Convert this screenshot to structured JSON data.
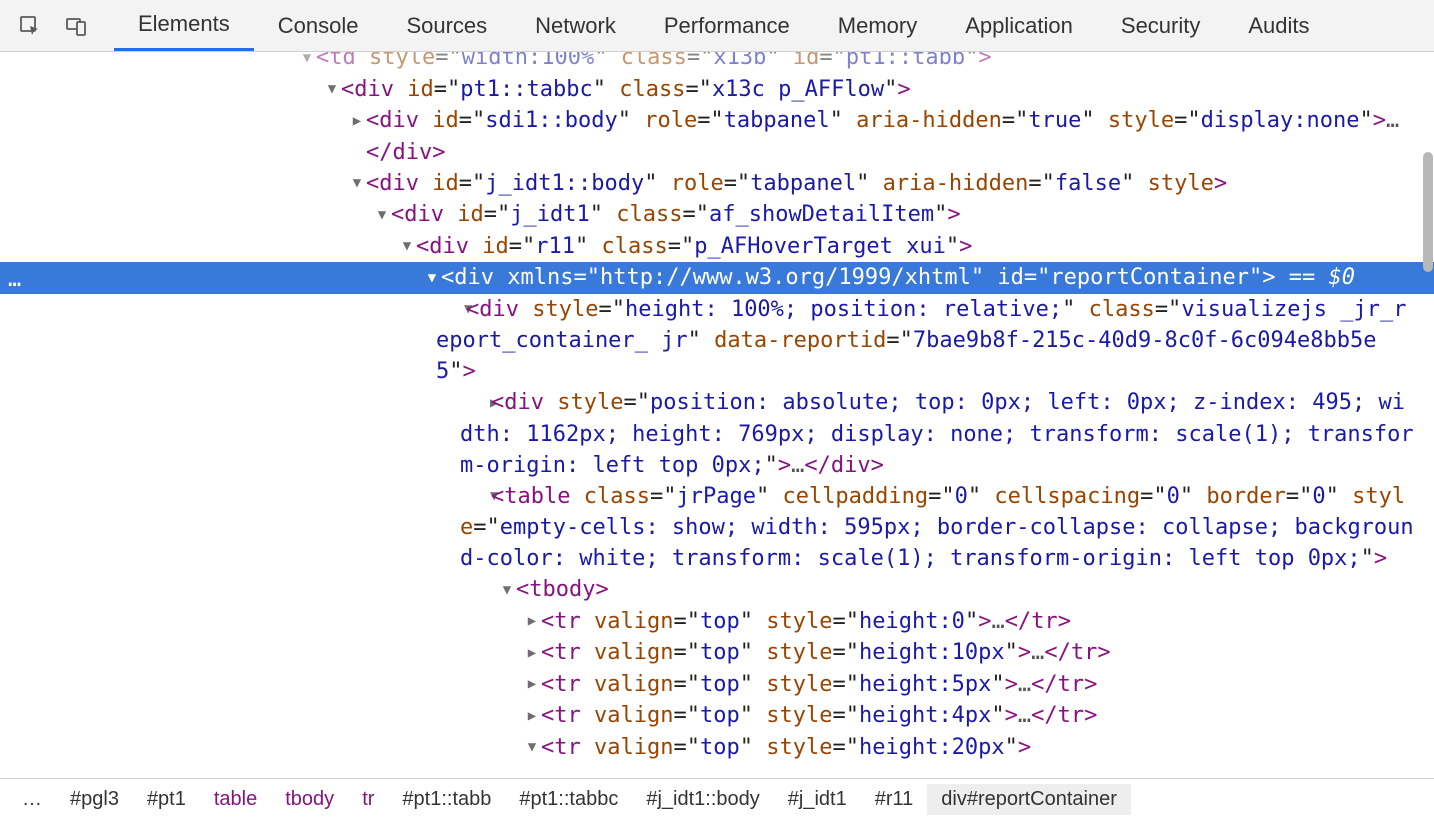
{
  "toolbar": {
    "tabs": [
      "Elements",
      "Console",
      "Sources",
      "Network",
      "Performance",
      "Memory",
      "Application",
      "Security",
      "Audits"
    ],
    "active_tab": "Elements"
  },
  "dom_lines": [
    {
      "indent": 300,
      "arrow": "down",
      "html": "<span class='punct'>&lt;</span><span class='tag'>td</span> <span class='attr'>style</span>=\"<span class='val'>width:100%</span>\" <span class='attr'>class</span>=\"<span class='val'>x13b</span>\" <span class='attr'>id</span>=\"<span class='val'>pt1::tabb</span>\"<span class='punct'>&gt;</span>",
      "cutoff_top": true
    },
    {
      "indent": 325,
      "arrow": "down",
      "html": "<span class='punct'>&lt;</span><span class='tag'>div</span> <span class='attr'>id</span>=\"<span class='val'>pt1::tabbc</span>\" <span class='attr'>class</span>=\"<span class='val'>x13c p_AFFlow</span>\"<span class='punct'>&gt;</span>"
    },
    {
      "indent": 350,
      "arrow": "right",
      "html": "<span class='punct'>&lt;</span><span class='tag'>div</span> <span class='attr'>id</span>=\"<span class='val'>sdi1::body</span>\" <span class='attr'>role</span>=\"<span class='val'>tabpanel</span>\" <span class='attr'>aria-hidden</span>=\"<span class='val'>true</span>\" <span class='attr'>style</span>=\"<span class='val'>display:none</span>\"<span class='punct'>&gt;</span><span class='ellip'>…</span>"
    },
    {
      "indent": 350,
      "arrow": "",
      "html": "<span class='punct'>&lt;/</span><span class='tag'>div</span><span class='punct'>&gt;</span>"
    },
    {
      "indent": 350,
      "arrow": "down",
      "html": "<span class='punct'>&lt;</span><span class='tag'>div</span> <span class='attr'>id</span>=\"<span class='val'>j_idt1::body</span>\" <span class='attr'>role</span>=\"<span class='val'>tabpanel</span>\" <span class='attr'>aria-hidden</span>=\"<span class='val'>false</span>\" <span class='attr'>style</span><span class='punct'>&gt;</span>"
    },
    {
      "indent": 375,
      "arrow": "down",
      "html": "<span class='punct'>&lt;</span><span class='tag'>div</span> <span class='attr'>id</span>=\"<span class='val'>j_idt1</span>\" <span class='attr'>class</span>=\"<span class='val'>af_showDetailItem</span>\"<span class='punct'>&gt;</span>"
    },
    {
      "indent": 400,
      "arrow": "down",
      "html": "<span class='punct'>&lt;</span><span class='tag'>div</span> <span class='attr'>id</span>=\"<span class='val'>r11</span>\" <span class='attr'>class</span>=\"<span class='val'>p_AFHoverTarget xui</span>\"<span class='punct'>&gt;</span>"
    },
    {
      "indent": 425,
      "arrow": "down",
      "selected": true,
      "html": "<span class='punct'>&lt;</span><span class='tag'>div</span> <span class='attr'>xmlns</span>=\"<span class='val'>http://www.w3.org/1999/xhtml</span>\" <span class='attr'>id</span>=\"<span class='val'>reportContainer</span>\"<span class='punct'>&gt;</span> <span class='ellip'>==</span> <span class='dz'>$0</span>"
    },
    {
      "indent": 450,
      "arrow": "down",
      "wrapped": true,
      "hang": 436,
      "html": "<span class='punct'>&lt;</span><span class='tag'>div</span> <span class='attr'>style</span>=\"<span class='val'>height: 100%; position: relative;</span>\" <span class='attr'>class</span>=\"<span class='val'>visualizejs _jr_report_container_ jr</span>\" <span class='attr'>data-reportid</span>=\"<span class='val'>7bae9b8f-215c-40d9-8c0f-6c094e8bb5e5</span>\"<span class='punct'>&gt;</span>"
    },
    {
      "indent": 475,
      "arrow": "right",
      "wrapped": true,
      "hang": 460,
      "html": "<span class='punct'>&lt;</span><span class='tag'>div</span> <span class='attr'>style</span>=\"<span class='val'>position: absolute; top: 0px; left: 0px; z-index: 495; width: 1162px; height: 769px; display: none; transform: scale(1); transform-origin: left top 0px;</span>\"<span class='punct'>&gt;</span><span class='ellip'>…</span><span class='punct'>&lt;/</span><span class='tag'>div</span><span class='punct'>&gt;</span>"
    },
    {
      "indent": 475,
      "arrow": "down",
      "wrapped": true,
      "hang": 460,
      "html": "<span class='punct'>&lt;</span><span class='tag'>table</span> <span class='attr'>class</span>=\"<span class='val'>jrPage</span>\" <span class='attr'>cellpadding</span>=\"<span class='val'>0</span>\" <span class='attr'>cellspacing</span>=\"<span class='val'>0</span>\" <span class='attr'>border</span>=\"<span class='val'>0</span>\" <span class='attr'>style</span>=\"<span class='val'>empty-cells: show; width: 595px; border-collapse: collapse; background-color: white; transform: scale(1); transform-origin: left top 0px;</span>\"<span class='punct'>&gt;</span>"
    },
    {
      "indent": 500,
      "arrow": "down",
      "html": "<span class='punct'>&lt;</span><span class='tag'>tbody</span><span class='punct'>&gt;</span>"
    },
    {
      "indent": 525,
      "arrow": "right",
      "html": "<span class='punct'>&lt;</span><span class='tag'>tr</span> <span class='attr'>valign</span>=\"<span class='val'>top</span>\" <span class='attr'>style</span>=\"<span class='val'>height:0</span>\"<span class='punct'>&gt;</span><span class='ellip'>…</span><span class='punct'>&lt;/</span><span class='tag'>tr</span><span class='punct'>&gt;</span>"
    },
    {
      "indent": 525,
      "arrow": "right",
      "html": "<span class='punct'>&lt;</span><span class='tag'>tr</span> <span class='attr'>valign</span>=\"<span class='val'>top</span>\" <span class='attr'>style</span>=\"<span class='val'>height:10px</span>\"<span class='punct'>&gt;</span><span class='ellip'>…</span><span class='punct'>&lt;/</span><span class='tag'>tr</span><span class='punct'>&gt;</span>"
    },
    {
      "indent": 525,
      "arrow": "right",
      "html": "<span class='punct'>&lt;</span><span class='tag'>tr</span> <span class='attr'>valign</span>=\"<span class='val'>top</span>\" <span class='attr'>style</span>=\"<span class='val'>height:5px</span>\"<span class='punct'>&gt;</span><span class='ellip'>…</span><span class='punct'>&lt;/</span><span class='tag'>tr</span><span class='punct'>&gt;</span>"
    },
    {
      "indent": 525,
      "arrow": "right",
      "html": "<span class='punct'>&lt;</span><span class='tag'>tr</span> <span class='attr'>valign</span>=\"<span class='val'>top</span>\" <span class='attr'>style</span>=\"<span class='val'>height:4px</span>\"<span class='punct'>&gt;</span><span class='ellip'>…</span><span class='punct'>&lt;/</span><span class='tag'>tr</span><span class='punct'>&gt;</span>"
    },
    {
      "indent": 525,
      "arrow": "down",
      "html": "<span class='punct'>&lt;</span><span class='tag'>tr</span> <span class='attr'>valign</span>=\"<span class='val'>top</span>\" <span class='attr'>style</span>=\"<span class='val'>height:20px</span>\"<span class='punct'>&gt;</span>"
    }
  ],
  "breadcrumbs": [
    {
      "label": "…",
      "pseudo": false
    },
    {
      "label": "#pgl3",
      "pseudo": false
    },
    {
      "label": "#pt1",
      "pseudo": false
    },
    {
      "label": "table",
      "pseudo": true
    },
    {
      "label": "tbody",
      "pseudo": true
    },
    {
      "label": "tr",
      "pseudo": true
    },
    {
      "label": "#pt1::tabb",
      "pseudo": false
    },
    {
      "label": "#pt1::tabbc",
      "pseudo": false
    },
    {
      "label": "#j_idt1::body",
      "pseudo": false
    },
    {
      "label": "#j_idt1",
      "pseudo": false
    },
    {
      "label": "#r11",
      "pseudo": false
    },
    {
      "label": "div#reportContainer",
      "pseudo": false,
      "selected": true
    }
  ],
  "gutter_dots": "…"
}
